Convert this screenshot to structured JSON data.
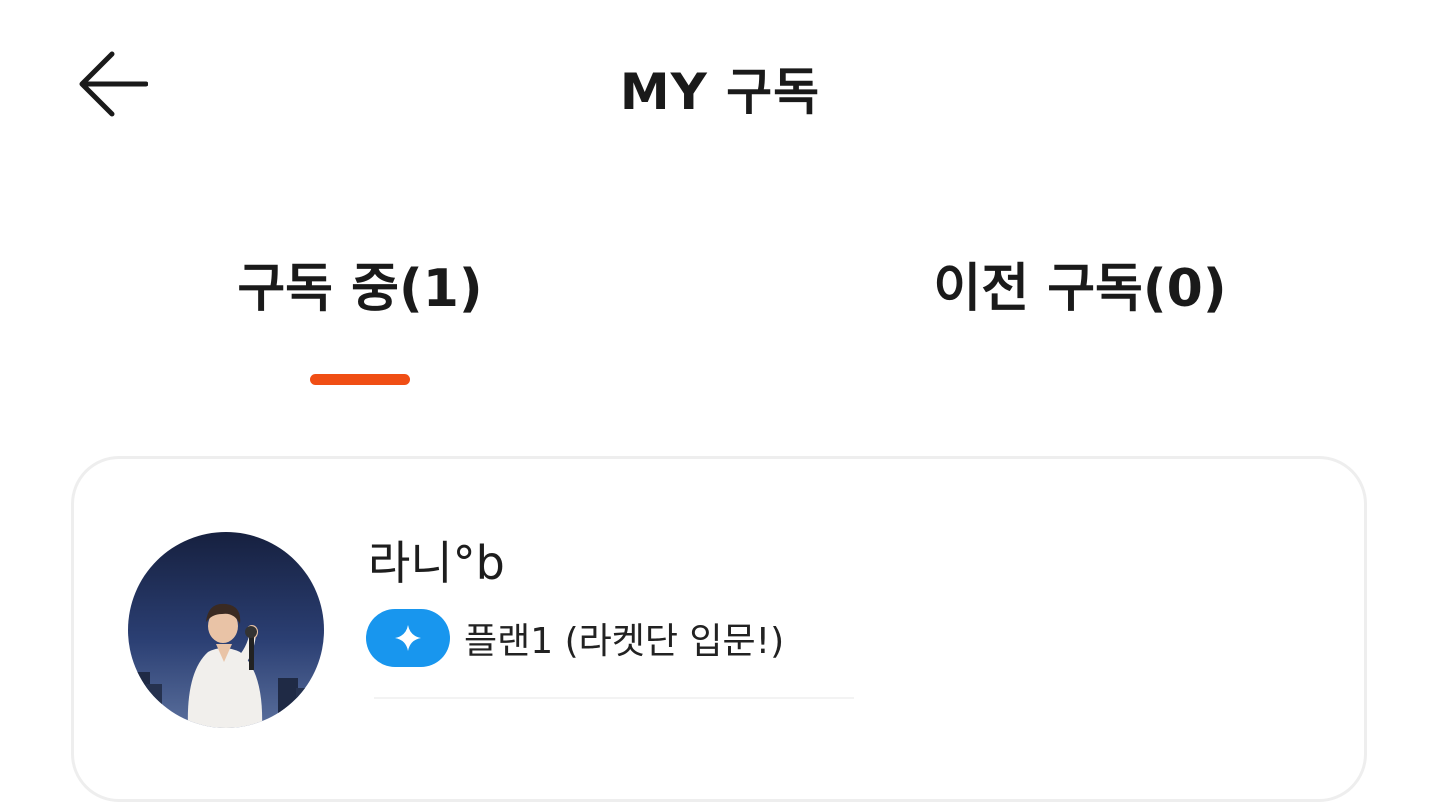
{
  "header": {
    "title": "MY 구독",
    "back_icon": "arrow-left-icon"
  },
  "tabs": [
    {
      "label": "구독 중(1)",
      "active": true
    },
    {
      "label": "이전 구독(0)",
      "active": false
    }
  ],
  "colors": {
    "accent": "#f04e14",
    "badge": "#1896ee",
    "card_border": "#eeeeee"
  },
  "subscriptions": [
    {
      "creator_name": "라니°b",
      "plan_icon": "sparkle-icon",
      "plan_label": "플랜1 (라켓단 입문!)"
    }
  ]
}
